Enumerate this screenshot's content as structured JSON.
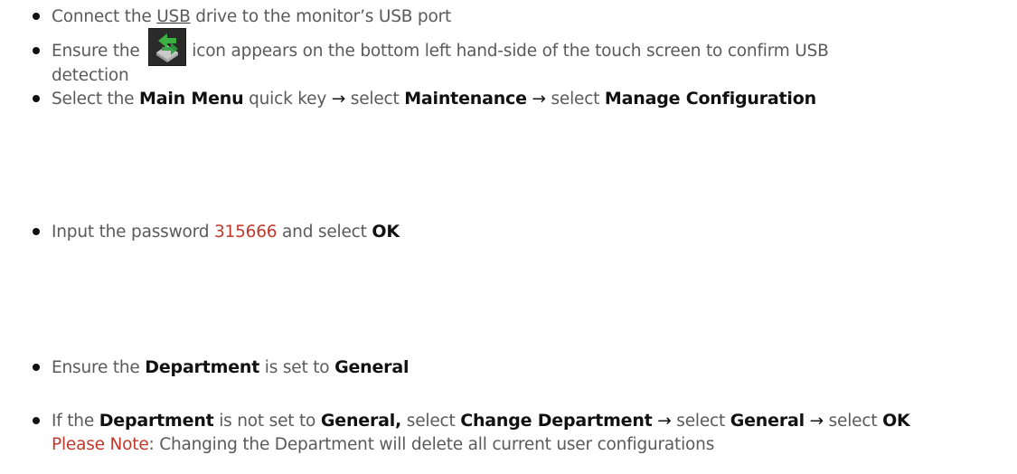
{
  "steps": [
    {
      "id": "connect",
      "pre": "Connect the ",
      "usb": "USB",
      "post": " drive to the monitor’s USB port"
    },
    {
      "id": "icon",
      "pre": "Ensure the ",
      "post_line1": "icon appears on the bottom left hand-side of the touch screen to confirm USB",
      "line2": "detection",
      "icon_name": "usb-detected-icon"
    },
    {
      "id": "menu",
      "pre": "Select the ",
      "main_menu": "Main Menu",
      "mid1": " quick key ",
      "arrow": "→",
      "select1": " select ",
      "maintenance": "Maintenance",
      "select2": " select ",
      "manage_config": "Manage Configuration"
    },
    {
      "id": "password",
      "pre": "Input the password ",
      "password": "315666",
      "mid": " and select ",
      "ok": "OK"
    },
    {
      "id": "department",
      "pre": "Ensure the ",
      "department": "Department",
      "mid": " is set to ",
      "general": "General"
    },
    {
      "id": "change",
      "pre": "If the ",
      "department": "Department",
      "mid": " is not set to ",
      "general_comma": "General,",
      "select1": " select ",
      "change_department": "Change Department",
      "select2": " select ",
      "general": "General",
      "select3": " select ",
      "ok": "OK",
      "note_label": "Please Note",
      "note_text": ": Changing the Department will delete all current user configurations"
    }
  ],
  "colors": {
    "body_text": "#5a5a5a",
    "keyword": "#111111",
    "highlight_red": "#c0392b",
    "icon_green": "#3cb043"
  }
}
